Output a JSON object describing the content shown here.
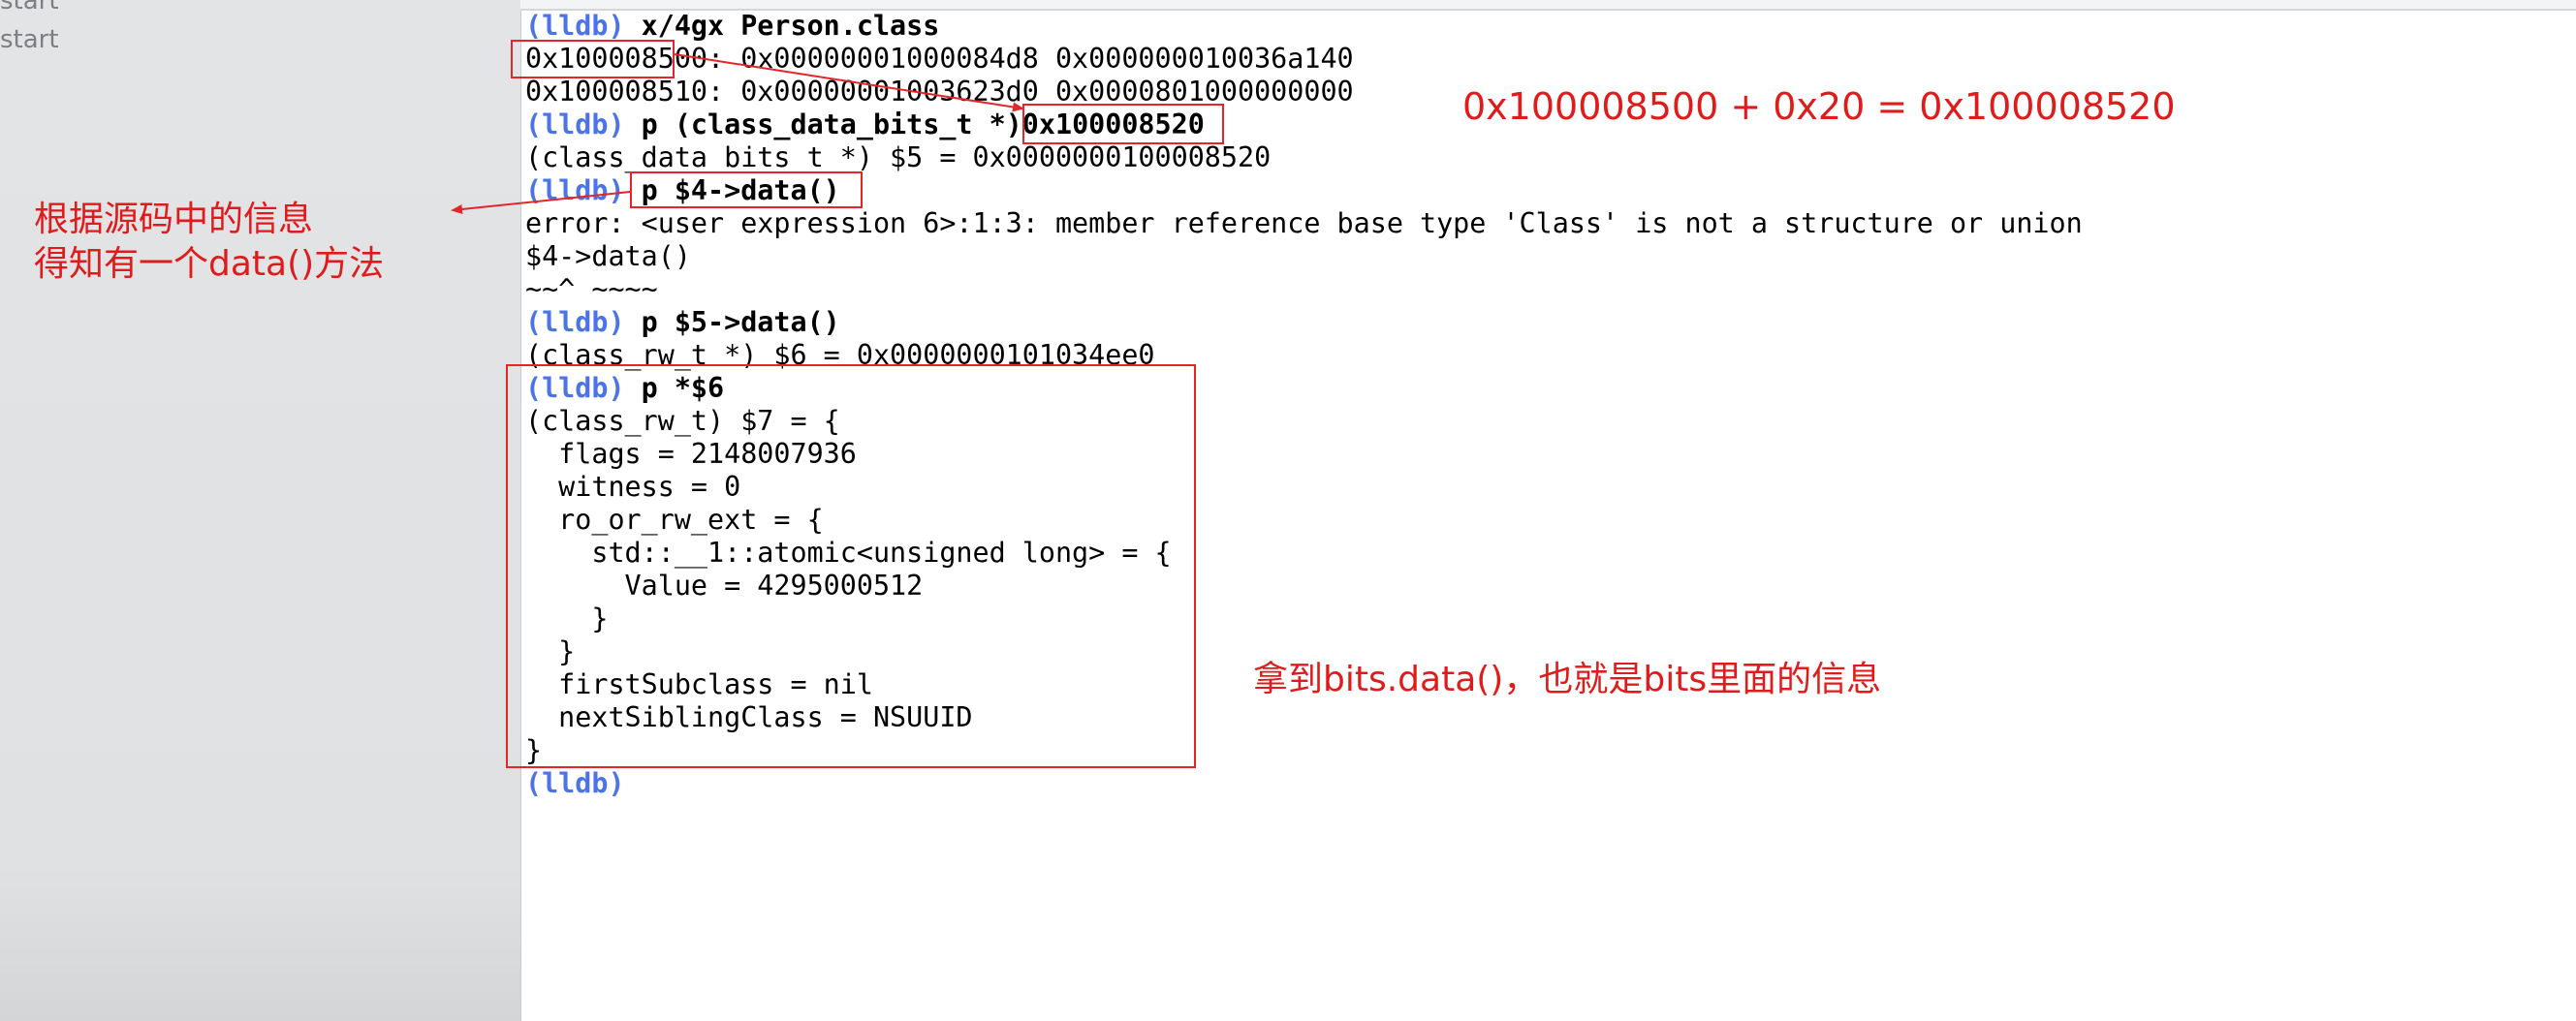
{
  "sidebar": {
    "items": [
      "start",
      "start"
    ]
  },
  "console": {
    "prompt": "(lldb)",
    "lines": [
      {
        "type": "cmd",
        "text": " x/4gx Person.class"
      },
      {
        "type": "out",
        "text": "0x100008500: 0x00000001000084d8 0x000000010036a140"
      },
      {
        "type": "out",
        "text": "0x100008510: 0x00000001003623d0 0x0000801000000000"
      },
      {
        "type": "cmd",
        "text": " p (class_data_bits_t *)0x100008520"
      },
      {
        "type": "out",
        "text": "(class_data_bits_t *) $5 = 0x0000000100008520"
      },
      {
        "type": "cmd",
        "text": " p $4->data()"
      },
      {
        "type": "out",
        "text": "error: <user expression 6>:1:3: member reference base type 'Class' is not a structure or union"
      },
      {
        "type": "out",
        "text": "$4->data()"
      },
      {
        "type": "out",
        "text": "~~^ ~~~~"
      },
      {
        "type": "cmd",
        "text": " p $5->data()"
      },
      {
        "type": "out",
        "text": "(class_rw_t *) $6 = 0x0000000101034ee0"
      },
      {
        "type": "cmd",
        "text": " p *$6"
      },
      {
        "type": "out",
        "text": "(class_rw_t) $7 = {"
      },
      {
        "type": "out",
        "text": "  flags = 2148007936"
      },
      {
        "type": "out",
        "text": "  witness = 0"
      },
      {
        "type": "out",
        "text": "  ro_or_rw_ext = {"
      },
      {
        "type": "out",
        "text": "    std::__1::atomic<unsigned long> = {"
      },
      {
        "type": "out",
        "text": "      Value = 4295000512"
      },
      {
        "type": "out",
        "text": "    }"
      },
      {
        "type": "out",
        "text": "  }"
      },
      {
        "type": "out",
        "text": "  firstSubclass = nil"
      },
      {
        "type": "out",
        "text": "  nextSiblingClass = NSUUID"
      },
      {
        "type": "out",
        "text": "}"
      },
      {
        "type": "prompt",
        "text": ""
      }
    ]
  },
  "annotations": {
    "address_calc": "0x100008500 + 0x20 = 0x100008520",
    "source_info_line1": "根据源码中的信息",
    "source_info_line2": "得知有一个data()方法",
    "bits_info": "拿到bits.data()，也就是bits里面的信息"
  },
  "colors": {
    "annotation": "#e01b1b",
    "prompt": "#4a74e8",
    "sidebar": "#e0e2e4"
  }
}
